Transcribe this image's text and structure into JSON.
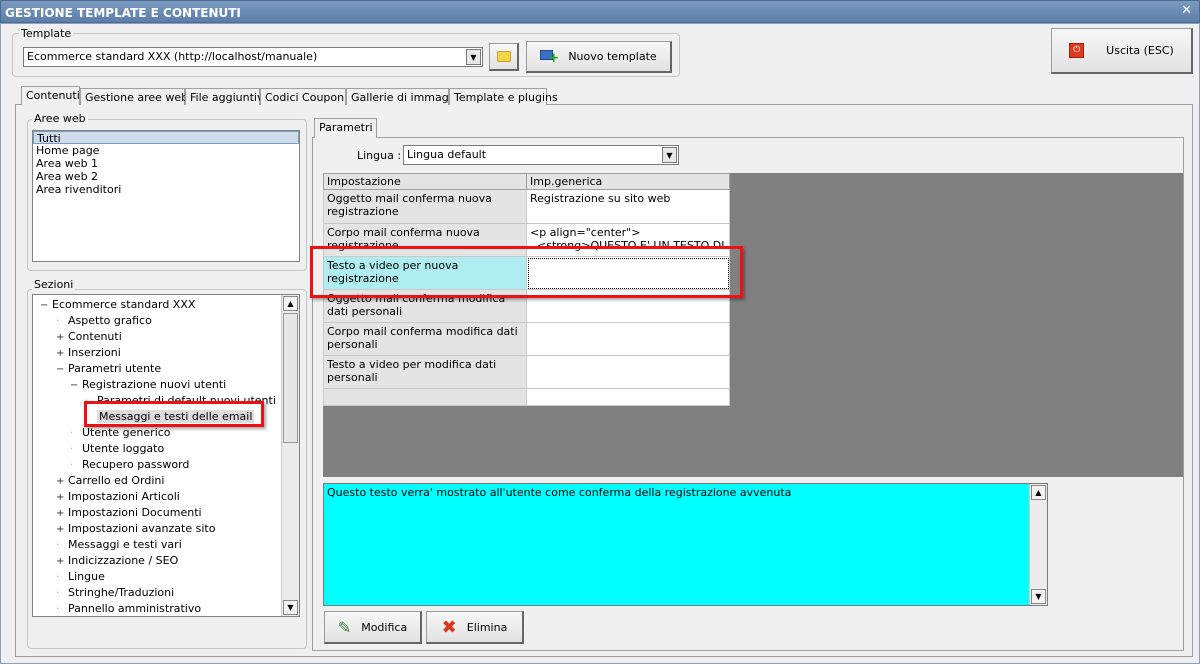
{
  "window": {
    "title": "GESTIONE TEMPLATE E CONTENUTI",
    "close": "✕"
  },
  "template": {
    "group_label": "Template",
    "selected": "Ecommerce standard XXX (http://localhost/manuale)",
    "new_button": "Nuovo template"
  },
  "exit_button": "Uscita (ESC)",
  "tabs": [
    "Contenuti",
    "Gestione aree web",
    "File aggiuntivi",
    "Codici Coupon",
    "Gallerie di immagini",
    "Template e plugins"
  ],
  "aree_web": {
    "label": "Aree web",
    "items": [
      "Tutti",
      "Home page",
      "Area web 1",
      "Area web 2",
      "Area rivenditori"
    ],
    "selected_index": 0
  },
  "sezioni": {
    "label": "Sezioni",
    "items": [
      {
        "label": "Ecommerce standard XXX",
        "level": 0,
        "toggle": "−"
      },
      {
        "label": "Aspetto grafico",
        "level": 1,
        "toggle": ""
      },
      {
        "label": "Contenuti",
        "level": 1,
        "toggle": "+"
      },
      {
        "label": "Inserzioni",
        "level": 1,
        "toggle": "+"
      },
      {
        "label": "Parametri utente",
        "level": 1,
        "toggle": "−"
      },
      {
        "label": "Registrazione nuovi utenti",
        "level": 2,
        "toggle": "−"
      },
      {
        "label": "Parametri di default nuovi utenti",
        "level": 3,
        "toggle": ""
      },
      {
        "label": "Messaggi e testi delle email",
        "level": 3,
        "toggle": "",
        "selected": true
      },
      {
        "label": "Utente generico",
        "level": 2,
        "toggle": ""
      },
      {
        "label": "Utente loggato",
        "level": 2,
        "toggle": ""
      },
      {
        "label": "Recupero password",
        "level": 2,
        "toggle": ""
      },
      {
        "label": "Carrello ed Ordini",
        "level": 1,
        "toggle": "+"
      },
      {
        "label": "Impostazioni Articoli",
        "level": 1,
        "toggle": "+"
      },
      {
        "label": "Impostazioni Documenti",
        "level": 1,
        "toggle": "+"
      },
      {
        "label": "Impostazioni avanzate sito",
        "level": 1,
        "toggle": "+"
      },
      {
        "label": "Messaggi e testi vari",
        "level": 1,
        "toggle": ""
      },
      {
        "label": "Indicizzazione / SEO",
        "level": 1,
        "toggle": "+"
      },
      {
        "label": "Lingue",
        "level": 1,
        "toggle": ""
      },
      {
        "label": "Stringhe/Traduzioni",
        "level": 1,
        "toggle": ""
      },
      {
        "label": "Pannello amministrativo",
        "level": 1,
        "toggle": ""
      }
    ]
  },
  "parametri": {
    "tab": "Parametri",
    "lingua_label": "Lingua :",
    "lingua_value": "Lingua default",
    "columns": [
      "Impostazione",
      "Imp.generica"
    ],
    "rows": [
      {
        "name": "Oggetto mail conferma nuova registrazione",
        "value": "Registrazione su sito web"
      },
      {
        "name": "Corpo mail conferma nuova registrazione",
        "value": "<p align=\"center\">\n  <strong>QUESTO E' UN TESTO DI"
      },
      {
        "name": "Testo a video per nuova registrazione",
        "value": "",
        "selected": true
      },
      {
        "name": "Oggetto mail conferma modifica dati personali",
        "value": ""
      },
      {
        "name": "Corpo mail conferma modifica dati personali",
        "value": ""
      },
      {
        "name": "Testo a video per modifica dati personali",
        "value": ""
      },
      {
        "name": "",
        "value": ""
      }
    ],
    "description": "Questo testo verra' mostrato all'utente come conferma della registrazione avvenuta",
    "modify_button": "Modifica",
    "delete_button": "Elimina"
  },
  "colors": {
    "highlight": "#ee1111",
    "description_bg": "#00ffff",
    "selected_row": "#aeeef0"
  }
}
